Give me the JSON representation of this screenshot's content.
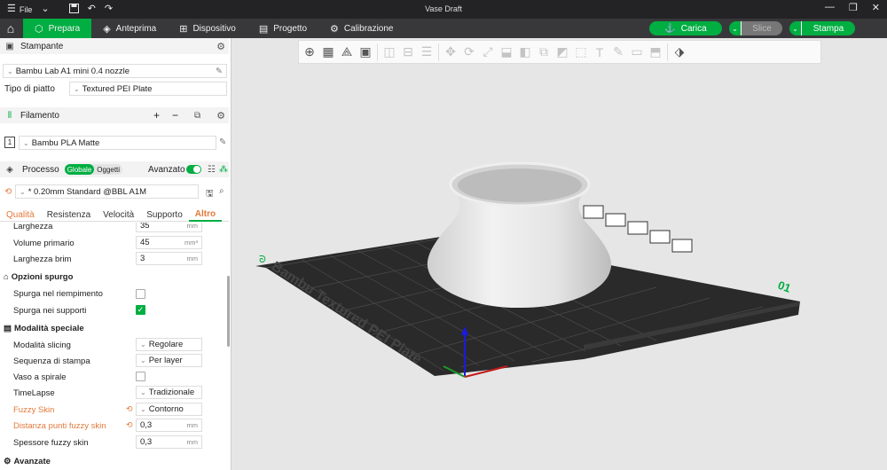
{
  "titlebar": {
    "menu_label": "File",
    "title": "Vase Draft"
  },
  "toolbar": {
    "tabs": [
      {
        "label": "Prepara",
        "icon": "cube-icon",
        "active": true
      },
      {
        "label": "Anteprima",
        "icon": "layers-icon",
        "active": false
      },
      {
        "label": "Dispositivo",
        "icon": "device-icon",
        "active": false
      },
      {
        "label": "Progetto",
        "icon": "project-icon",
        "active": false
      },
      {
        "label": "Calibrazione",
        "icon": "calibration-icon",
        "active": false
      }
    ],
    "load_label": "Carica",
    "slice_label": "Slice",
    "print_label": "Stampa",
    "accent_color": "#00ae42"
  },
  "printer": {
    "section_label": "Stampante",
    "printer_name": "Bambu Lab A1 mini 0.4 nozzle",
    "plate_label": "Tipo di piatto",
    "plate_value": "Textured PEI Plate"
  },
  "filament": {
    "section_label": "Filamento",
    "slot_number": "1",
    "filament_name": "Bambu PLA Matte"
  },
  "process": {
    "section_label": "Processo",
    "toggle_global": "Globale",
    "toggle_objects": "Oggetti",
    "advanced_label": "Avanzato",
    "preset": "* 0.20mm Standard @BBL A1M",
    "tabs": [
      {
        "label": "Qualità",
        "warn": true,
        "active": false
      },
      {
        "label": "Resistenza",
        "warn": false,
        "active": false
      },
      {
        "label": "Velocità",
        "warn": false,
        "active": false
      },
      {
        "label": "Supporto",
        "warn": false,
        "active": false
      },
      {
        "label": "Altro",
        "warn": true,
        "active": true
      }
    ]
  },
  "settings": {
    "larghezza": {
      "label": "Larghezza",
      "value": "35",
      "unit": "mm"
    },
    "volume": {
      "label": "Volume primario",
      "value": "45",
      "unit": "mm³"
    },
    "brim": {
      "label": "Larghezza brim",
      "value": "3",
      "unit": "mm"
    },
    "purge_group": "Opzioni spurgo",
    "purge_infill": {
      "label": "Spurga nel riempimento",
      "checked": false
    },
    "purge_support": {
      "label": "Spurga nei supporti",
      "checked": true
    },
    "special_group": "Modalità speciale",
    "slicing_mode": {
      "label": "Modalità slicing",
      "value": "Regolare"
    },
    "print_sequence": {
      "label": "Sequenza di stampa",
      "value": "Per layer"
    },
    "spiral_vase": {
      "label": "Vaso a spirale",
      "checked": false
    },
    "timelapse": {
      "label": "TimeLapse",
      "value": "Tradizionale"
    },
    "fuzzy_skin": {
      "label": "Fuzzy Skin",
      "value": "Contorno"
    },
    "fuzzy_distance": {
      "label": "Distanza punti fuzzy skin",
      "value": "0,3",
      "unit": "mm"
    },
    "fuzzy_thickness": {
      "label": "Spessore fuzzy skin",
      "value": "0,3",
      "unit": "mm"
    },
    "advanced_group": "Avanzate"
  },
  "plate": {
    "label_text": "Bambu Textured PEI Plate",
    "plate_number": "01"
  }
}
